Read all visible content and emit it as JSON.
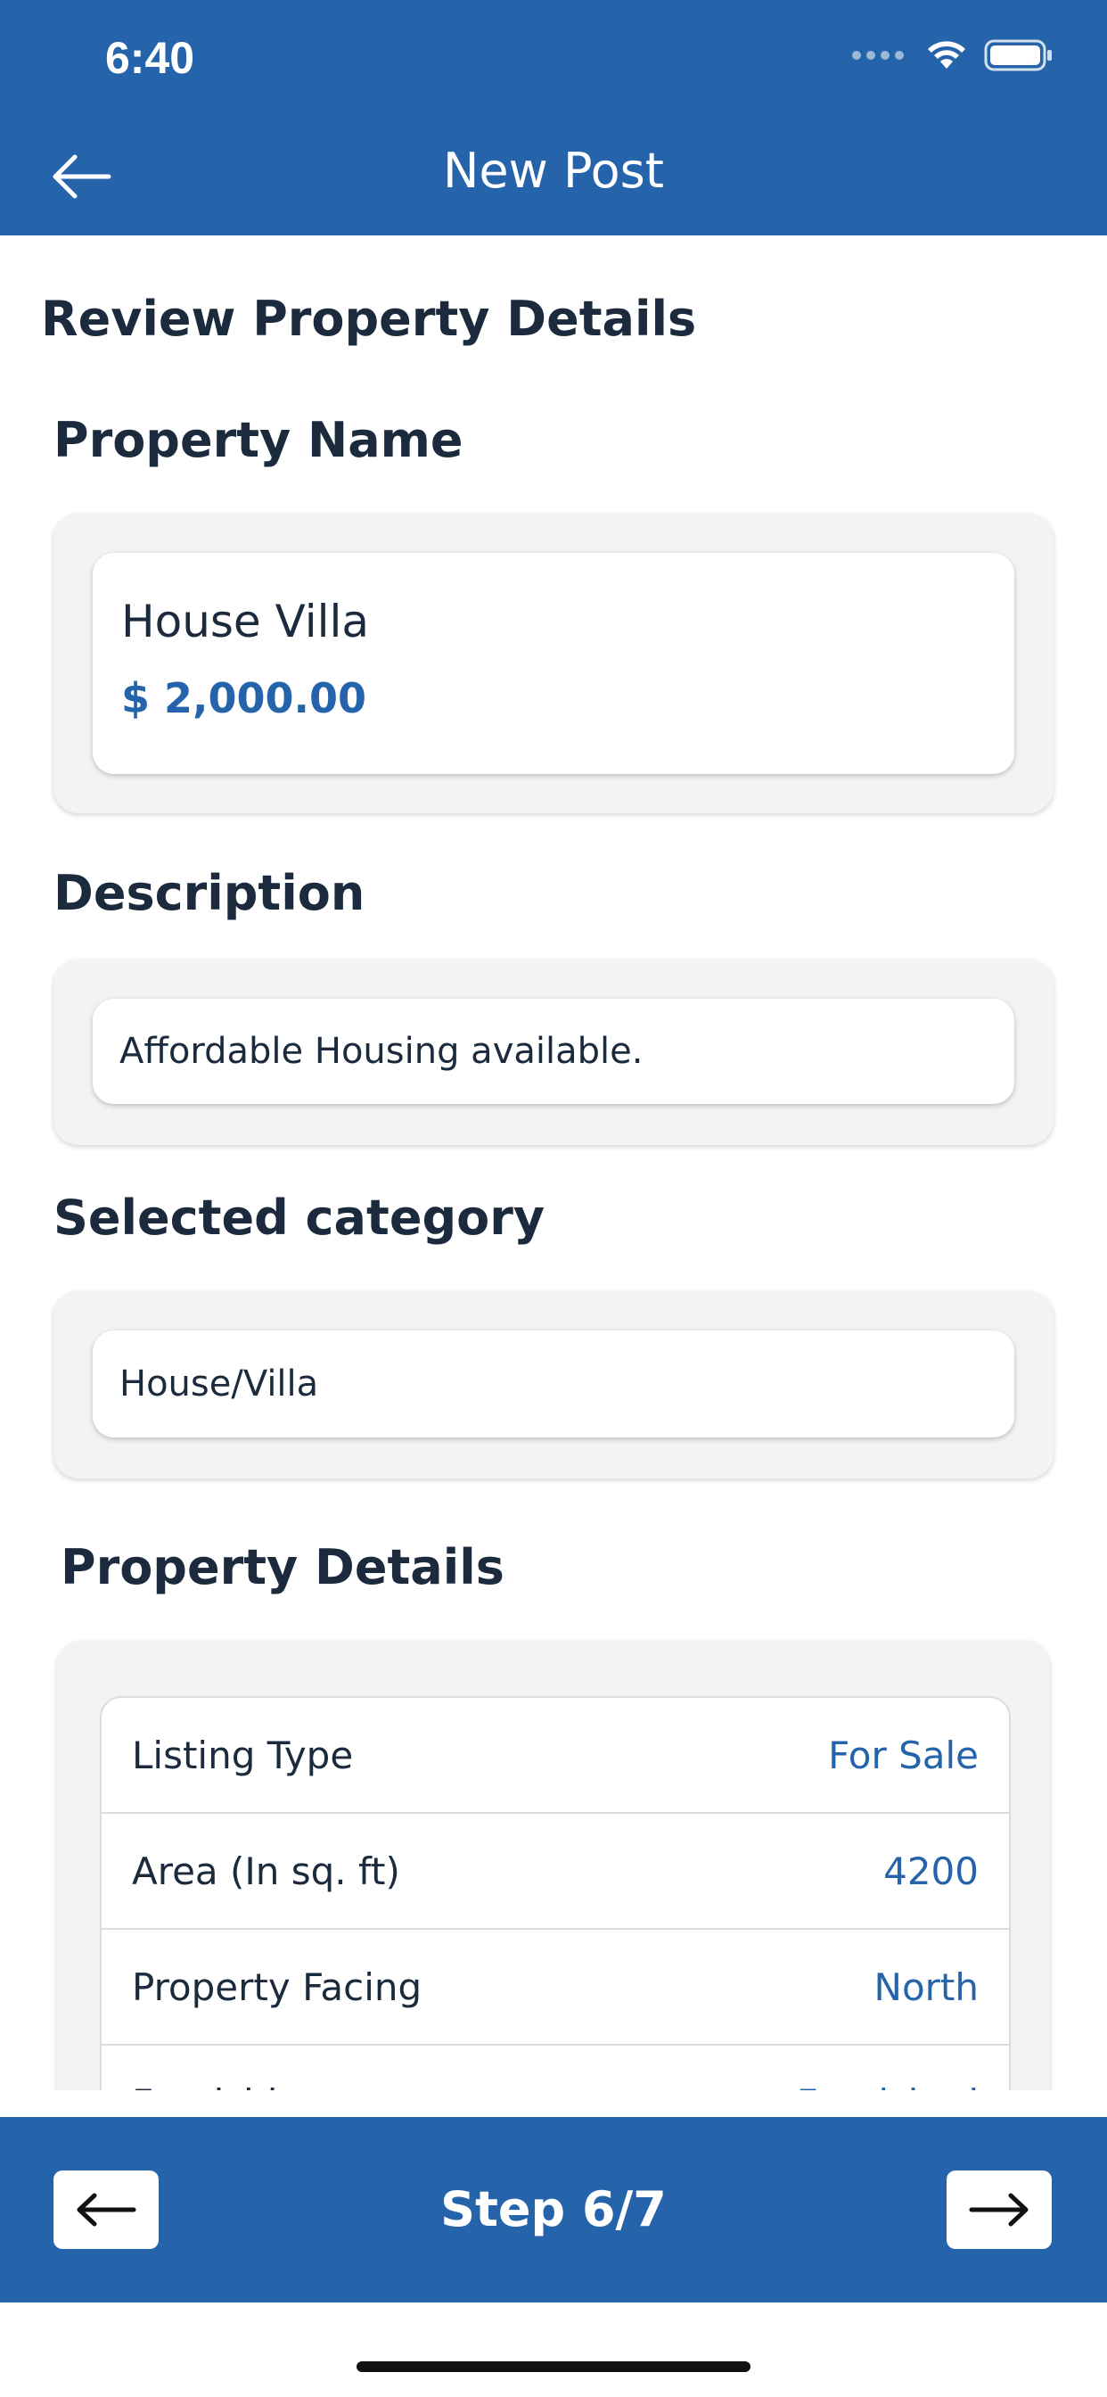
{
  "status_bar": {
    "time": "6:40"
  },
  "header": {
    "title": "New Post"
  },
  "page": {
    "heading": "Review Property Details"
  },
  "property_name": {
    "label": "Property Name",
    "name": "House Villa",
    "price": "$ 2,000.00"
  },
  "description": {
    "label": "Description",
    "text": "Affordable Housing available."
  },
  "category": {
    "label": "Selected category",
    "value": "House/Villa"
  },
  "property_details": {
    "label": "Property Details",
    "rows": [
      {
        "key": "Listing Type",
        "value": "For Sale"
      },
      {
        "key": "Area (In sq. ft)",
        "value": "4200"
      },
      {
        "key": "Property Facing",
        "value": "North"
      },
      {
        "key": "Furnishing",
        "value": "Furnished"
      }
    ]
  },
  "footer": {
    "step": "Step 6/7"
  },
  "colors": {
    "primary": "#2563ab",
    "card_bg": "#f3f3f3",
    "text": "#1b2a3c"
  }
}
